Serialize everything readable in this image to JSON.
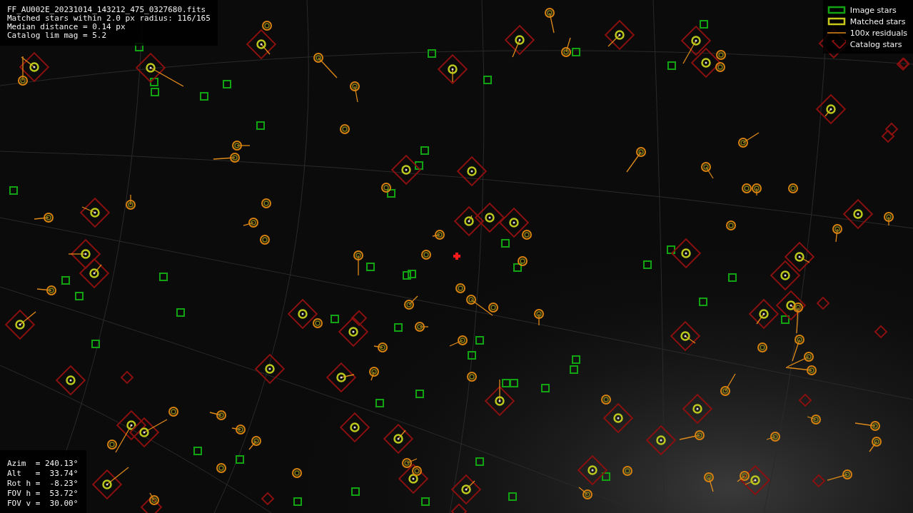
{
  "info_lines": [
    "FF_AU002E_20231014_143212_475_0327680.fits",
    "Matched stars within 2.0 px radius: 116/165",
    "Median distance = 0.14 px",
    "Catalog lim mag = 5.2"
  ],
  "legend": [
    {
      "kind": "image",
      "label": "Image stars"
    },
    {
      "kind": "matched",
      "label": "Matched stars"
    },
    {
      "kind": "residual",
      "label": "100x residuals"
    },
    {
      "kind": "catalog",
      "label": "Catalog stars"
    }
  ],
  "pointing": [
    "Azim  = 240.13°",
    "Alt   =  33.74°",
    "Rot h =  -8.23°",
    "FOV h =  53.72°",
    "FOV v =  30.00°"
  ]
}
